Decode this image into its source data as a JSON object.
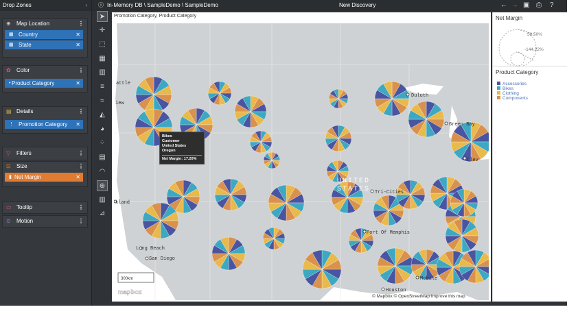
{
  "panel": {
    "title": "Drop Zones",
    "collapse_icon": "chevron-left-icon"
  },
  "sections": {
    "map_location": {
      "title": "Map Location",
      "items": [
        "Country",
        "State"
      ]
    },
    "color": {
      "title": "Color",
      "items": [
        "Product Category"
      ]
    },
    "details": {
      "title": "Details",
      "items": [
        "Promotion Category"
      ]
    },
    "filters": {
      "title": "Filters"
    },
    "size": {
      "title": "Size",
      "items": [
        "Net Margin"
      ]
    },
    "tooltip": {
      "title": "Tooltip"
    },
    "motion": {
      "title": "Motion"
    }
  },
  "topbar": {
    "breadcrumb": "In-Memory DB \\ SampleDemo \\ SampleDemo",
    "title": "New Discovery"
  },
  "map": {
    "card_title": "Promotion Category, Product Category",
    "scale_label": "300km",
    "brand": "mapbox",
    "attribution": "© Mapbox © OpenStreetMap Improve this map",
    "country_label_1": "UNITED",
    "country_label_2": "STATES",
    "cities": {
      "duluth": "Duluth",
      "green_bay": "Green Bay",
      "cleveland": "Clev",
      "seattle": "attle",
      "victoria": "iew",
      "oakland": "kland",
      "long_beach": "Long Beach",
      "san_diego": "San Diego",
      "tri_cities": "Tri-Cities",
      "port_of_memphis": "Port Of Memphis",
      "mobile": "Mobile",
      "houston": "Houston"
    }
  },
  "tooltip": {
    "category": "Bikes",
    "promotion": "Customer",
    "country": "United States",
    "state": "Oregon",
    "measure": "Net Margin:",
    "value": "17.20%"
  },
  "legend": {
    "size_title": "Net Margin",
    "size_max": "58.50%",
    "size_min": "-144.22%",
    "color_title": "Product Category",
    "categories": [
      {
        "name": "Accessories",
        "color": "#4a55a2"
      },
      {
        "name": "Bikes",
        "color": "#3ea8c2"
      },
      {
        "name": "Clothing",
        "color": "#e9b94b"
      },
      {
        "name": "Components",
        "color": "#d9924e"
      }
    ]
  },
  "colors": {
    "land": "#cfd2d4",
    "water": "#ffffff",
    "panel": "#35383c",
    "pill_blue": "#2e72b8",
    "pill_orange": "#e07b33"
  }
}
